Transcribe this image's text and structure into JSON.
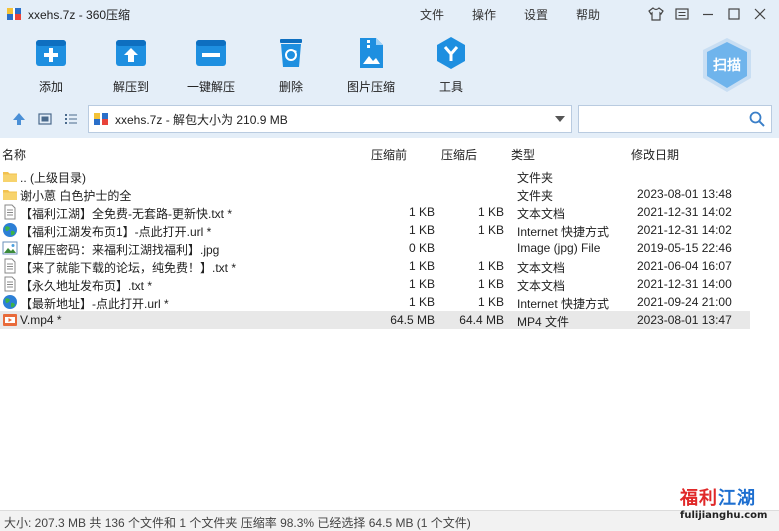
{
  "window": {
    "title": "xxehs.7z - 360压缩",
    "menu": [
      "文件",
      "操作",
      "设置",
      "帮助"
    ]
  },
  "toolbar": {
    "tools": [
      {
        "label": "添加",
        "icon": "add-archive-icon"
      },
      {
        "label": "解压到",
        "icon": "extract-to-icon"
      },
      {
        "label": "一键解压",
        "icon": "one-click-extract-icon"
      },
      {
        "label": "删除",
        "icon": "recycle-bin-icon"
      },
      {
        "label": "图片压缩",
        "icon": "image-compress-icon"
      },
      {
        "label": "工具",
        "icon": "tools-icon"
      }
    ],
    "scan_label": "扫描"
  },
  "address": {
    "path": "xxehs.7z - 解包大小为 210.9 MB",
    "search_placeholder": ""
  },
  "columns": {
    "name": "名称",
    "compressed": "压缩前",
    "original": "压缩后",
    "type": "类型",
    "modified": "修改日期"
  },
  "files": [
    {
      "icon": "folder-icon",
      "name": ".. (上级目录)",
      "compressed": "",
      "original": "",
      "type": "文件夹",
      "date": ""
    },
    {
      "icon": "folder-icon",
      "name": "谢小蒽 白色护士的全",
      "compressed": "",
      "original": "",
      "type": "文件夹",
      "date": "2023-08-01 13:48"
    },
    {
      "icon": "text-file-icon",
      "name": "【福利江湖】全免费-无套路-更新快.txt *",
      "compressed": "1 KB",
      "original": "1 KB",
      "type": "文本文档",
      "date": "2021-12-31 14:02"
    },
    {
      "icon": "internet-shortcut-icon",
      "name": "【福利江湖发布页1】-点此打开.url *",
      "compressed": "1 KB",
      "original": "1 KB",
      "type": "Internet 快捷方式",
      "date": "2021-12-31 14:02"
    },
    {
      "icon": "image-file-icon",
      "name": "【解压密码：来福利江湖找福利】.jpg",
      "compressed": "0 KB",
      "original": "",
      "type": "Image (jpg) File",
      "date": "2019-05-15 22:46"
    },
    {
      "icon": "text-file-icon",
      "name": "【来了就能下载的论坛，纯免费！】.txt *",
      "compressed": "1 KB",
      "original": "1 KB",
      "type": "文本文档",
      "date": "2021-06-04 16:07"
    },
    {
      "icon": "text-file-icon",
      "name": "【永久地址发布页】.txt *",
      "compressed": "1 KB",
      "original": "1 KB",
      "type": "文本文档",
      "date": "2021-12-31 14:00"
    },
    {
      "icon": "internet-shortcut-icon",
      "name": "【最新地址】-点此打开.url *",
      "compressed": "1 KB",
      "original": "1 KB",
      "type": "Internet 快捷方式",
      "date": "2021-09-24 21:00"
    },
    {
      "icon": "video-file-icon",
      "name": "V.mp4 *",
      "compressed": "64.5 MB",
      "original": "64.4 MB",
      "type": "MP4 文件",
      "date": "2023-08-01 13:47"
    }
  ],
  "status": "大小: 207.3 MB 共 136 个文件和 1 个文件夹 压缩率 98.3% 已经选择 64.5 MB (1 个文件)",
  "watermark": {
    "cn_red": "福利",
    "cn_blue": "江湖",
    "url": "fulijianghu.com"
  },
  "colors": {
    "chrome": "#e4eef8",
    "accent": "#1e8fe0",
    "selected_row": "#e8e8e8"
  }
}
